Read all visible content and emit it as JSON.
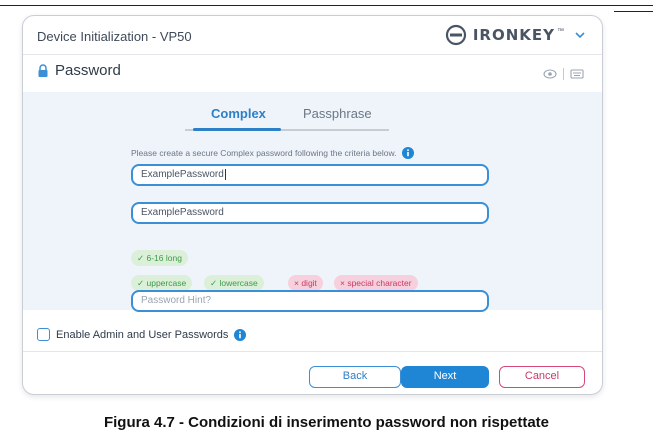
{
  "window": {
    "title": "Device Initialization - VP50",
    "brand": "IRONKEY",
    "brand_tm": "™"
  },
  "section": {
    "title": "Password"
  },
  "tabs": [
    {
      "label": "Complex",
      "active": true
    },
    {
      "label": "Passphrase",
      "active": false
    }
  ],
  "form": {
    "criteria_text": "Please create a secure Complex password following the criteria below.",
    "password_value": "ExamplePassword",
    "confirm_value": "ExamplePassword",
    "hint_placeholder": "Password Hint?"
  },
  "checks": [
    {
      "label": "✓ 6-16 long",
      "status": "ok"
    },
    {
      "label": "✓ uppercase",
      "status": "ok"
    },
    {
      "label": "✓ lowercase",
      "status": "ok"
    },
    {
      "label": "× digit",
      "status": "fail"
    },
    {
      "label": "× special character",
      "status": "fail"
    }
  ],
  "admin": {
    "label": "Enable Admin and User Passwords",
    "checked": false
  },
  "buttons": {
    "back": "Back",
    "next": "Next",
    "cancel": "Cancel"
  },
  "caption": "Figura 4.7 - Condizioni di inserimento password non rispettate",
  "colors": {
    "accent": "#2d7fc7",
    "ok": "#3c9a4a",
    "fail": "#c73a6a",
    "panel": "#eef4fa"
  },
  "icons": [
    "ironkey-logo-icon",
    "chevron-down-icon",
    "lock-icon",
    "eye-icon",
    "keyboard-icon",
    "info-icon"
  ]
}
